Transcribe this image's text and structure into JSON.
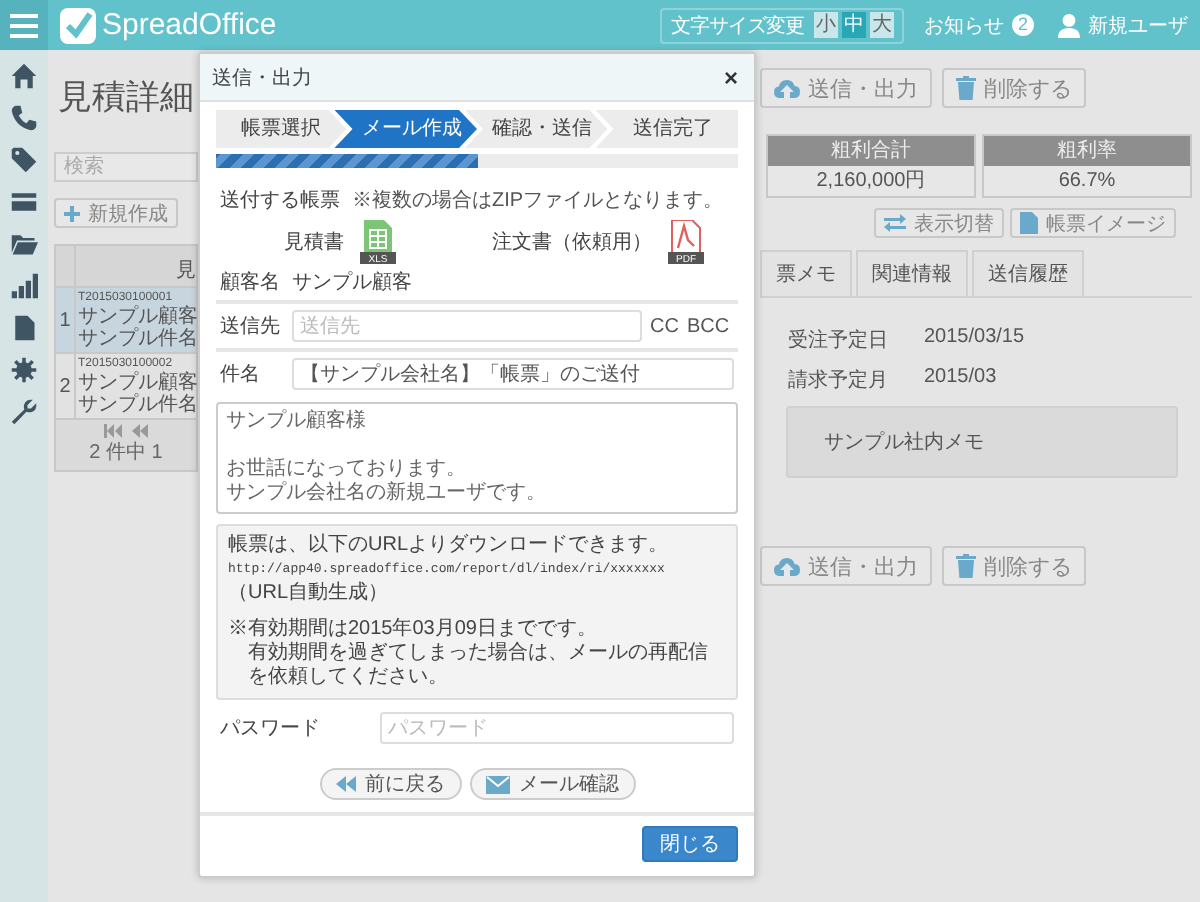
{
  "header": {
    "logo": "SpreadOffice",
    "font_size": {
      "label": "文字サイズ変更",
      "options": [
        {
          "label": "小",
          "selected": false
        },
        {
          "label": "中",
          "selected": true
        },
        {
          "label": "大",
          "selected": false
        }
      ]
    },
    "notifications": {
      "label": "お知らせ",
      "count": "2"
    },
    "user": "新規ユーザ"
  },
  "page": {
    "title": "見積詳細",
    "search_placeholder": "検索",
    "new_button": "新規作成",
    "list": {
      "column_header": "見",
      "rows": [
        {
          "number": "1",
          "code": "T2015030100001",
          "customer": "サンプル顧客",
          "subject": "サンプル件名",
          "selected": true
        },
        {
          "number": "2",
          "code": "T2015030100002",
          "customer": "サンプル顧客",
          "subject": "サンプル件名",
          "selected": false
        }
      ],
      "pager": "2 件中 1"
    },
    "actions": [
      {
        "kind": "send",
        "label": "送信・出力"
      },
      {
        "kind": "delete",
        "label": "削除する"
      }
    ],
    "summary": [
      {
        "header": "粗利合計",
        "value": "2,160,000円"
      },
      {
        "header": "粗利率",
        "value": "66.7%"
      }
    ],
    "view_buttons": [
      {
        "kind": "toggle",
        "label": "表示切替"
      },
      {
        "kind": "document",
        "label": "帳票イメージ"
      }
    ],
    "tabs": [
      {
        "label": "票メモ",
        "selected": false
      },
      {
        "label": "関連情報",
        "selected": false
      },
      {
        "label": "送信履歴",
        "selected": false
      }
    ],
    "details": [
      {
        "label": "受注予定日",
        "value": "2015/03/15"
      },
      {
        "label": "請求予定月",
        "value": "2015/03"
      }
    ],
    "memo": "サンプル社内メモ",
    "bottom_actions": [
      {
        "kind": "send",
        "label": "送信・出力"
      },
      {
        "kind": "delete",
        "label": "削除する"
      }
    ]
  },
  "dialog": {
    "title": "送信・出力",
    "close": "×",
    "steps": [
      {
        "label": "帳票選択",
        "selected": false
      },
      {
        "label": "メール作成",
        "selected": true
      },
      {
        "label": "確認・送信",
        "selected": false
      },
      {
        "label": "送信完了",
        "selected": false
      }
    ],
    "progress": {
      "level": 0.5
    },
    "attachments": {
      "label": "送付する帳票",
      "note": "※複数の場合はZIPファイルとなります。",
      "files": [
        {
          "name": "見積書",
          "kind": "xls",
          "badge": "XLS"
        },
        {
          "name": "注文書（依頼用）",
          "kind": "pdf",
          "badge": "PDF"
        }
      ]
    },
    "customer": {
      "label": "顧客名",
      "value": "サンプル顧客"
    },
    "to": {
      "label": "送信先",
      "placeholder": "送信先",
      "cc": "CC",
      "bcc": "BCC"
    },
    "subject": {
      "label": "件名",
      "value": "【サンプル会社名】「帳票」のご送付"
    },
    "body": [
      "サンプル顧客様",
      "お世話になっております。",
      "サンプル会社名の新規ユーザです。"
    ],
    "notice": {
      "intro": "帳票は、以下のURLよりダウンロードできます。",
      "url": "http://app40.spreadoffice.com/report/dl/index/ri/xxxxxxx",
      "url_note": "（URL自動生成）",
      "expiry": "※有効期間は2015年03月09日までです。",
      "expiry_note": "有効期間を過ぎてしまった場合は、メールの再配信を依頼してください。"
    },
    "password": {
      "label": "パスワード",
      "placeholder": "パスワード"
    },
    "nav_buttons": [
      {
        "kind": "back",
        "label": "前に戻る"
      },
      {
        "kind": "confirm",
        "label": "メール確認"
      }
    ],
    "close_button": "閉じる"
  }
}
